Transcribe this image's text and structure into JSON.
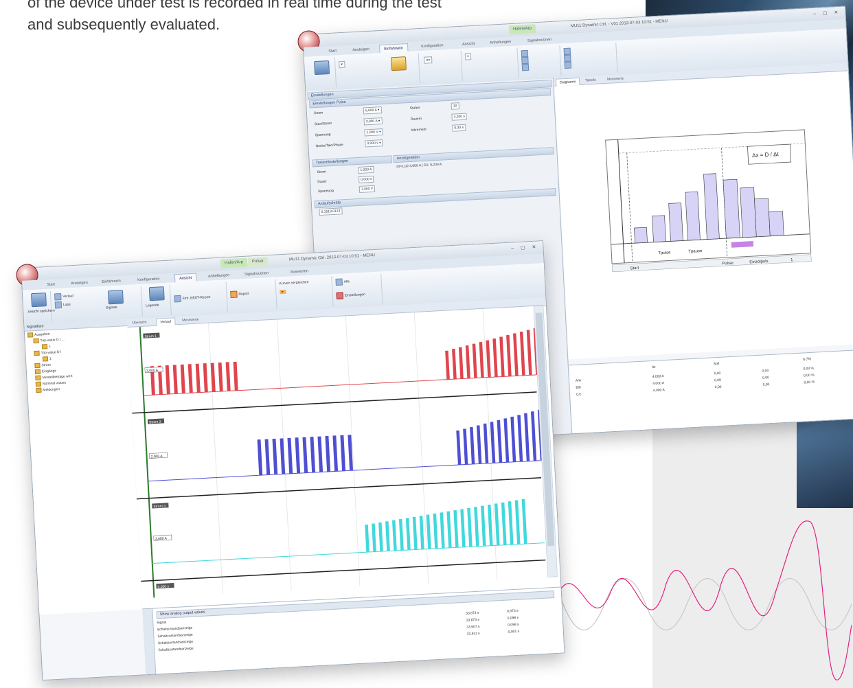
{
  "intro": {
    "line1": "of the device under test is recorded in real time during the test",
    "line2": "and subsequently evaluated."
  },
  "back_window": {
    "context_tab": "Hafen/Arp",
    "title": "MU11 Dynamic Ctrl. - V01 2013-07-03 10:51 - MENU",
    "tabs": [
      "Start",
      "Ansteigen",
      "Einfahrsein",
      "Konfiguration",
      "Ansicht",
      "Anheftungen",
      "Signalroutinen"
    ],
    "panel_tabs": [
      "Diagramm",
      "Tabelle",
      "Messwerte"
    ],
    "sections": {
      "einstellungen": "Einstellungen",
      "einstellungen_puls": "Einstellungen Pulse",
      "tastereinstellungen": "Tastereinstellungen",
      "anzeigefelder": "Anzeigefelder",
      "anlaufschritte": "Anlaufschritte"
    },
    "fields": [
      {
        "label": "Strom",
        "value": "6,000 A"
      },
      {
        "label": "Start/Strom",
        "value": "3,000 A"
      },
      {
        "label": "Spannung",
        "value": "1,000 V"
      },
      {
        "label": "Nocke/Takt/Phase",
        "value": "0,000 s"
      }
    ],
    "fields_right": [
      {
        "label": "Stufen",
        "value": "10"
      },
      {
        "label": "Dauern",
        "value": "4,200 s"
      },
      {
        "label": "Inkrement",
        "value": "0,30 s"
      }
    ],
    "taster_fields": [
      {
        "label": "Strom",
        "value": "1,000 A"
      },
      {
        "label": "Dauer",
        "value": "0,000 s"
      },
      {
        "label": "Spannung",
        "value": "1,000 V"
      }
    ],
    "anzeige_value": "ID=1,02  4,000 A  |  D1: 0,200 A",
    "anlauf_value": "0,1513,0123",
    "diagram": {
      "formula": "Δx = D / Δt",
      "t_label": "Tpulse",
      "t_label2": "Tpause",
      "footer_left": "Start",
      "footer_mid": "Pulsar",
      "footer_right": "Einzelpuls",
      "footer_num": "1"
    },
    "table": {
      "header": [
        "",
        "Ist",
        "Soll",
        "",
        "Δ (%)"
      ],
      "rows": [
        [
          "A/A",
          "4,000 A",
          "0,00",
          "0,00",
          "0,00 %"
        ],
        [
          "B/b",
          "4,000 A",
          "0,00",
          "0,00",
          "0,00 %"
        ],
        [
          "C/c",
          "4,000 A",
          "0,00",
          "0,00",
          "0,00 %"
        ]
      ]
    }
  },
  "front_window": {
    "context_tab": "Hafen/Arp",
    "context_tab2": "Pulsar",
    "title": "MU11 Dynamic Ctrl. 2013-07-03 10:51 - MENU",
    "tabs": [
      "Start",
      "Ansteigen",
      "Einfahrsein",
      "Konfiguration",
      "Ansicht",
      "Anheftungen",
      "Signalroutinen",
      "Auswerten"
    ],
    "ribbon_labels": [
      "Ansicht speichern",
      "Verlauf",
      "Lupe",
      "Signale",
      "Legende",
      "Einf. BEST-Report",
      "Report",
      "Kurven vergleichen",
      "Alle",
      "Einstellungen"
    ],
    "panel_tabs": [
      "Übersicht",
      "Verlauf",
      "Messwerte"
    ],
    "tree_header": "Signalliste",
    "tree_items": [
      "Ausgaben",
      "Trip-value D l ...",
      "1",
      "Trip-value D l",
      "1",
      "Strom",
      "Eingänge",
      "Verstellbeträge wert",
      "Nominal values",
      "Meldungen"
    ],
    "channel_labels": [
      "Strom 1",
      "Strom 2",
      "Strom 3"
    ],
    "channel_values": [
      "3,000 A",
      "2,000 A",
      "3,000 A"
    ],
    "time_label": "0,000 s",
    "bottom": {
      "header": "Show analog output values",
      "col1": "Signal",
      "rows": [
        {
          "name": "Schaltzustandsanzeige",
          "v1": "33,873 s",
          "v2": "0,873 s"
        },
        {
          "name": "Schaltzustandsanzeige",
          "v1": "33,873 s",
          "v2": "0,098 s"
        },
        {
          "name": "Schaltzustandsanzeige",
          "v1": "33,907 s",
          "v2": "0,098 s"
        },
        {
          "name": "Schaltzustandsanzeige",
          "v1": "33,911 s",
          "v2": "0,001 s"
        }
      ]
    }
  },
  "colors": {
    "red": "#e0454d",
    "blue": "#4f4fd2",
    "cyan": "#41d8dc",
    "diagram_fill": "#d6d3f6",
    "magenta": "#e2217f"
  }
}
